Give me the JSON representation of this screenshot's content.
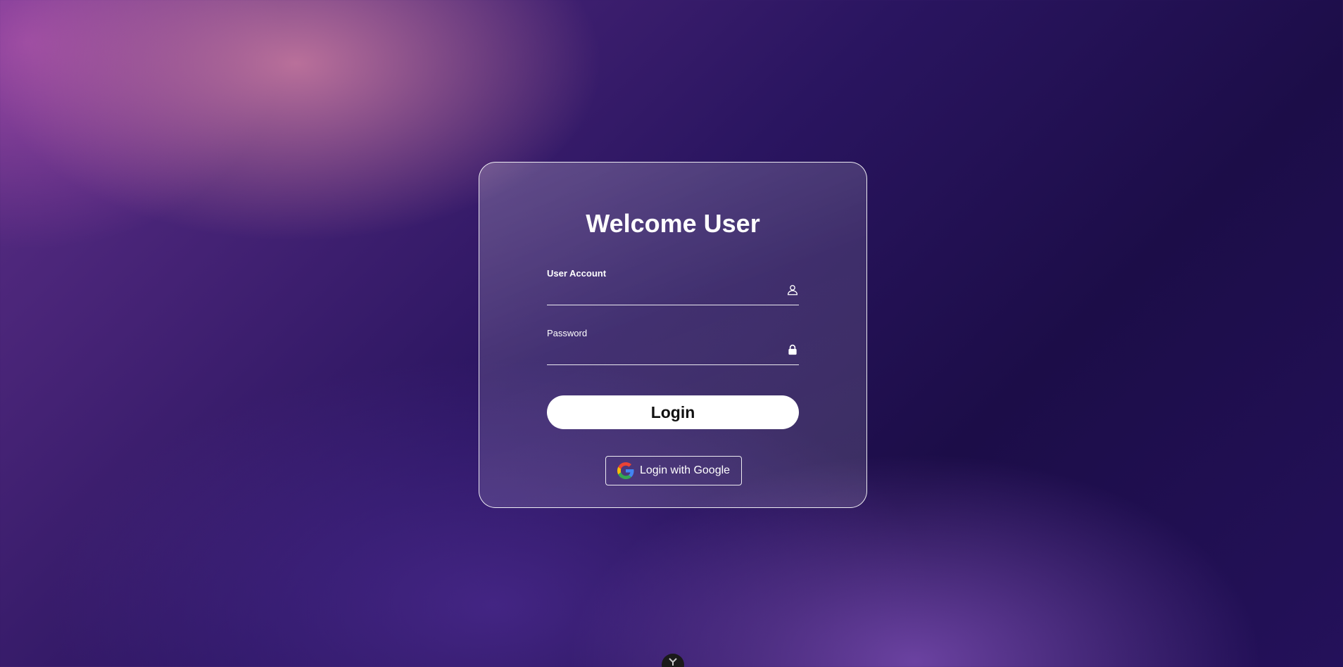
{
  "login_form": {
    "title": "Welcome User",
    "account_label": "User Account",
    "account_value": "",
    "password_label": "Password",
    "password_value": "",
    "login_label": "Login",
    "google_label": "Login with Google"
  },
  "icons": {
    "account": "user-icon",
    "password": "lock-icon",
    "google": "google-icon",
    "bottom_toggle": "chevron-down-icon"
  },
  "colors": {
    "card_border": "#ffffff",
    "button_bg": "#ffffff",
    "button_text": "#111111",
    "google_blue": "#4285F4",
    "google_red": "#EA4335",
    "google_yellow": "#FBBC05",
    "google_green": "#34A853"
  }
}
